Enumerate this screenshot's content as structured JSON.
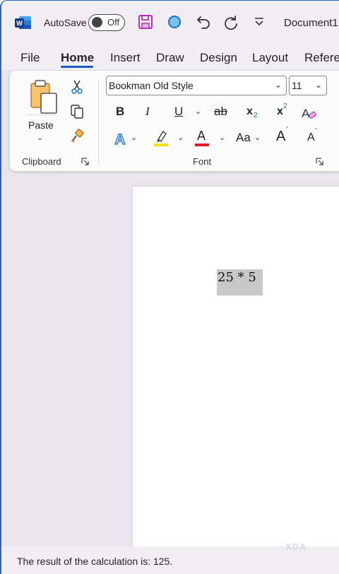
{
  "titlebar": {
    "autosave_label": "AutoSave",
    "autosave_state": "Off",
    "document_title": "Document1",
    "icons": [
      "word-logo-icon",
      "save-icon",
      "copilot-icon",
      "undo-icon",
      "redo-icon",
      "customize-quick-access-icon"
    ]
  },
  "tabs": [
    {
      "label": "File"
    },
    {
      "label": "Home",
      "active": true
    },
    {
      "label": "Insert"
    },
    {
      "label": "Draw"
    },
    {
      "label": "Design"
    },
    {
      "label": "Layout"
    },
    {
      "label": "Referer"
    }
  ],
  "ribbon": {
    "clipboard": {
      "paste_label": "Paste",
      "group_label": "Clipboard"
    },
    "font": {
      "font_name": "Bookman Old Style",
      "font_size": "11",
      "bold": "B",
      "italic": "I",
      "underline": "U",
      "strikethrough": "ab",
      "subscript": "x",
      "subscript_mark": "2",
      "superscript": "x",
      "superscript_mark": "2",
      "text_effects": "A",
      "font_color": "A",
      "change_case": "Aa",
      "grow_font": "A",
      "shrink_font": "A",
      "group_label": "Font",
      "highlight_color": "#f4e400",
      "font_color_value": "#e02020"
    }
  },
  "document": {
    "content": "25 * 5"
  },
  "statusbar": {
    "text": "The result of the calculation is: 125."
  },
  "watermark": "XDA",
  "colors": {
    "accent": "#185abd",
    "word_blue": "#2b63b6"
  }
}
